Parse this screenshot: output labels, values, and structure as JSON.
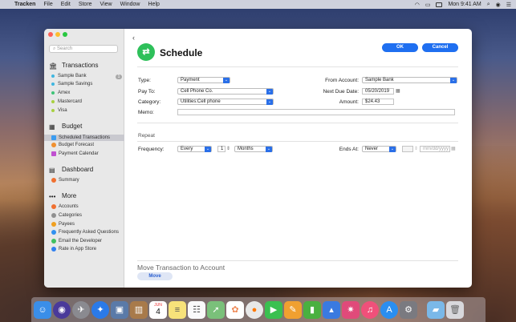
{
  "menubar": {
    "app_name": "Tracken",
    "items": [
      "File",
      "Edit",
      "Store",
      "View",
      "Window",
      "Help"
    ],
    "clock": "Mon 9:41 AM"
  },
  "sidebar": {
    "search_placeholder": "Search",
    "sections": {
      "transactions": "Transactions",
      "budget": "Budget",
      "dashboard": "Dashboard",
      "more": "More"
    },
    "accounts": [
      {
        "label": "Sample Bank",
        "color": "#3fb6e0",
        "badge": "1"
      },
      {
        "label": "Sample Savings",
        "color": "#3fb6e0"
      },
      {
        "label": "Amex",
        "color": "#3fc478"
      },
      {
        "label": "Mastercard",
        "color": "#a8d040"
      },
      {
        "label": "Visa",
        "color": "#a8d040"
      }
    ],
    "budget_items": [
      {
        "label": "Scheduled Transactions",
        "color": "#3b9cf0",
        "icon": "calendar-icon"
      },
      {
        "label": "Budget Forecast",
        "color": "#f09030",
        "icon": "forecast-icon"
      },
      {
        "label": "Payment Calendar",
        "color": "#c050d0",
        "icon": "calendar-icon"
      }
    ],
    "dashboard_items": [
      {
        "label": "Summary",
        "color": "#f07030",
        "icon": "summary-icon"
      }
    ],
    "more_items": [
      {
        "label": "Accounts",
        "color": "#f07030"
      },
      {
        "label": "Categories",
        "color": "#909090"
      },
      {
        "label": "Payees",
        "color": "#f0a020"
      },
      {
        "label": "Frequently Asked Questions",
        "color": "#3090f0"
      },
      {
        "label": "Email the Developer",
        "color": "#40c060"
      },
      {
        "label": "Rate in App Store",
        "color": "#3080f0"
      }
    ]
  },
  "main": {
    "title": "Schedule",
    "ok_label": "OK",
    "cancel_label": "Cancel",
    "type_label": "Type:",
    "type_value": "Payment",
    "payto_label": "Pay To:",
    "payto_value": "Cell Phone Co.",
    "category_label": "Category:",
    "category_value": "Utilities:Cell phone",
    "memo_label": "Memo:",
    "memo_value": "",
    "from_account_label": "From Account:",
    "from_account_value": "Sample Bank",
    "next_due_label": "Next Due Date:",
    "next_due_value": "05/20/2019",
    "amount_label": "Amount:",
    "amount_value": "$24.43",
    "repeat_label": "Repeat",
    "frequency_label": "Frequency:",
    "frequency_value": "Every",
    "frequency_count": "1",
    "frequency_unit": "Months",
    "ends_at_label": "Ends At:",
    "ends_at_value": "Never",
    "end_date_placeholder": "mm/dd/yyyy",
    "move_title": "Move Transaction to Account",
    "move_button": "Move"
  },
  "dock": {
    "items": [
      "finder-icon",
      "siri-icon",
      "launchpad-icon",
      "safari-icon",
      "photo-preview-icon",
      "notes-book-icon",
      "calendar-icon",
      "notes-icon",
      "reminders-icon",
      "maps-icon",
      "photos-icon",
      "messages-icon",
      "facetime-icon",
      "pages-icon",
      "numbers-icon",
      "keynote-icon",
      "tracken-icon",
      "itunes-icon",
      "app-store-icon",
      "system-preferences-icon",
      "folder-icon",
      "trash-icon"
    ],
    "calendar_day": "4",
    "calendar_month": "JUN"
  },
  "colors": {
    "accent": "#1f6ff0",
    "schedule_logo": "#2ec05a",
    "sidebar_bg": "#e8e8e8"
  }
}
